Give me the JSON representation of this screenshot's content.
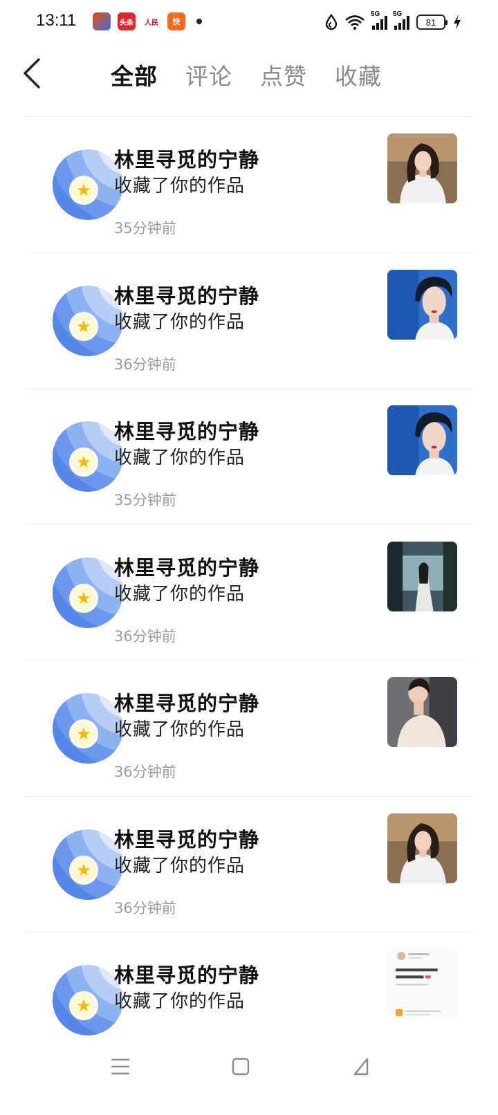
{
  "status_bar": {
    "time": "13:11",
    "notifications": [
      "game-app-icon",
      "toutiao-icon",
      "renmin-icon",
      "kuaishou-icon"
    ],
    "notif_labels": {
      "toutiao": "头条",
      "renmin": "人民",
      "kuai": "快"
    },
    "signal_1": "5G",
    "signal_2": "5G",
    "battery": "81"
  },
  "header": {
    "tabs": [
      {
        "label": "全部",
        "active": true
      },
      {
        "label": "评论",
        "active": false
      },
      {
        "label": "点赞",
        "active": false
      },
      {
        "label": "收藏",
        "active": false
      }
    ]
  },
  "notifications": [
    {
      "name": "林里寻觅的宁静",
      "action": "收藏了你的作品",
      "time": "35分钟前",
      "thumb": "portrait-white-top"
    },
    {
      "name": "林里寻觅的宁静",
      "action": "收藏了你的作品",
      "time": "36分钟前",
      "thumb": "portrait-blue-qipao"
    },
    {
      "name": "林里寻觅的宁静",
      "action": "收藏了你的作品",
      "time": "35分钟前",
      "thumb": "portrait-blue-qipao"
    },
    {
      "name": "林里寻觅的宁静",
      "action": "收藏了你的作品",
      "time": "36分钟前",
      "thumb": "lady-by-window"
    },
    {
      "name": "林里寻觅的宁静",
      "action": "收藏了你的作品",
      "time": "36分钟前",
      "thumb": "lady-lace-dress"
    },
    {
      "name": "林里寻觅的宁静",
      "action": "收藏了你的作品",
      "time": "36分钟前",
      "thumb": "portrait-white-top"
    },
    {
      "name": "林里寻觅的宁静",
      "action": "收藏了你的作品",
      "time": "",
      "thumb": "text-post-screenshot"
    }
  ],
  "colors": {
    "accent_blue": "#5586e8",
    "star": "#f5b800",
    "muted_text": "#9c9c9c"
  },
  "nav_bar": [
    "menu-icon",
    "home-square-icon",
    "back-triangle-icon"
  ]
}
